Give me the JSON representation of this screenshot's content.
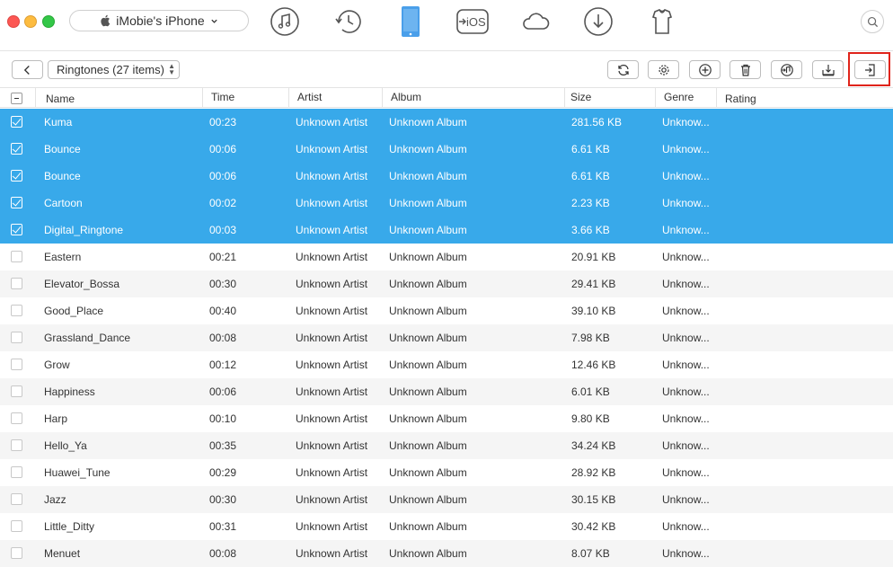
{
  "device": {
    "name": "iMobie's iPhone"
  },
  "nav": [
    {
      "name": "music-nav-icon"
    },
    {
      "name": "history-nav-icon"
    },
    {
      "name": "device-nav-icon"
    },
    {
      "name": "to-ios-nav-icon",
      "label": "iOS"
    },
    {
      "name": "cloud-nav-icon"
    },
    {
      "name": "download-nav-icon"
    },
    {
      "name": "toolkit-nav-icon"
    }
  ],
  "category": {
    "label": "Ringtones (27 items)"
  },
  "colors": {
    "selection": "#38a9ea",
    "highlight": "#e0241b",
    "active_nav": "#4a9fea"
  },
  "columns": [
    "Name",
    "Time",
    "Artist",
    "Album",
    "Size",
    "Genre",
    "Rating"
  ],
  "rows": [
    {
      "selected": true,
      "name": "Kuma",
      "time": "00:23",
      "artist": "Unknown Artist",
      "album": "Unknown Album",
      "size": "281.56 KB",
      "genre": "Unknow..."
    },
    {
      "selected": true,
      "name": "Bounce",
      "time": "00:06",
      "artist": "Unknown Artist",
      "album": "Unknown Album",
      "size": "6.61 KB",
      "genre": "Unknow..."
    },
    {
      "selected": true,
      "name": "Bounce",
      "time": "00:06",
      "artist": "Unknown Artist",
      "album": "Unknown Album",
      "size": "6.61 KB",
      "genre": "Unknow..."
    },
    {
      "selected": true,
      "name": "Cartoon",
      "time": "00:02",
      "artist": "Unknown Artist",
      "album": "Unknown Album",
      "size": "2.23 KB",
      "genre": "Unknow..."
    },
    {
      "selected": true,
      "name": "Digital_Ringtone",
      "time": "00:03",
      "artist": "Unknown Artist",
      "album": "Unknown Album",
      "size": "3.66 KB",
      "genre": "Unknow..."
    },
    {
      "selected": false,
      "name": "Eastern",
      "time": "00:21",
      "artist": "Unknown Artist",
      "album": "Unknown Album",
      "size": "20.91 KB",
      "genre": "Unknow..."
    },
    {
      "selected": false,
      "name": "Elevator_Bossa",
      "time": "00:30",
      "artist": "Unknown Artist",
      "album": "Unknown Album",
      "size": "29.41 KB",
      "genre": "Unknow..."
    },
    {
      "selected": false,
      "name": "Good_Place",
      "time": "00:40",
      "artist": "Unknown Artist",
      "album": "Unknown Album",
      "size": "39.10 KB",
      "genre": "Unknow..."
    },
    {
      "selected": false,
      "name": "Grassland_Dance",
      "time": "00:08",
      "artist": "Unknown Artist",
      "album": "Unknown Album",
      "size": "7.98 KB",
      "genre": "Unknow..."
    },
    {
      "selected": false,
      "name": "Grow",
      "time": "00:12",
      "artist": "Unknown Artist",
      "album": "Unknown Album",
      "size": "12.46 KB",
      "genre": "Unknow..."
    },
    {
      "selected": false,
      "name": "Happiness",
      "time": "00:06",
      "artist": "Unknown Artist",
      "album": "Unknown Album",
      "size": "6.01 KB",
      "genre": "Unknow..."
    },
    {
      "selected": false,
      "name": "Harp",
      "time": "00:10",
      "artist": "Unknown Artist",
      "album": "Unknown Album",
      "size": "9.80 KB",
      "genre": "Unknow..."
    },
    {
      "selected": false,
      "name": "Hello_Ya",
      "time": "00:35",
      "artist": "Unknown Artist",
      "album": "Unknown Album",
      "size": "34.24 KB",
      "genre": "Unknow..."
    },
    {
      "selected": false,
      "name": "Huawei_Tune",
      "time": "00:29",
      "artist": "Unknown Artist",
      "album": "Unknown Album",
      "size": "28.92 KB",
      "genre": "Unknow..."
    },
    {
      "selected": false,
      "name": "Jazz",
      "time": "00:30",
      "artist": "Unknown Artist",
      "album": "Unknown Album",
      "size": "30.15 KB",
      "genre": "Unknow..."
    },
    {
      "selected": false,
      "name": "Little_Ditty",
      "time": "00:31",
      "artist": "Unknown Artist",
      "album": "Unknown Album",
      "size": "30.42 KB",
      "genre": "Unknow..."
    },
    {
      "selected": false,
      "name": "Menuet",
      "time": "00:08",
      "artist": "Unknown Artist",
      "album": "Unknown Album",
      "size": "8.07 KB",
      "genre": "Unknow..."
    }
  ]
}
